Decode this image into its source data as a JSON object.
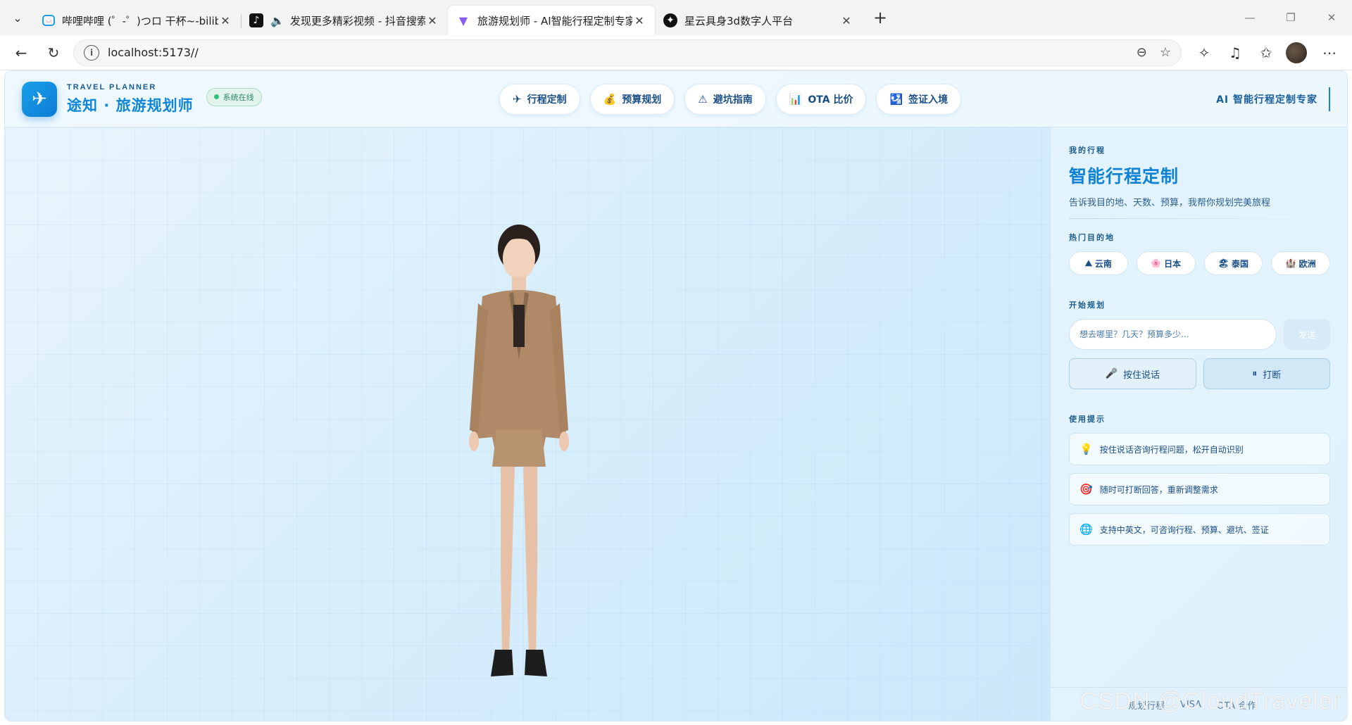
{
  "browser": {
    "tabs": [
      {
        "title": "哔哩哔哩 (゜-゜)つロ 干杯~-bilibili",
        "favicon": "bilibili-icon"
      },
      {
        "title": "发现更多精彩视频 - 抖音搜索",
        "favicon": "douyin-icon"
      },
      {
        "title": "旅游规划师 - AI智能行程定制专家",
        "favicon": "vite-icon"
      },
      {
        "title": "星云具身3d数字人平台",
        "favicon": "nebula-icon"
      }
    ],
    "url": "localhost:5173//"
  },
  "header": {
    "brand_sub": "TRAVEL PLANNER",
    "brand_title": "途知 · 旅游规划师",
    "status": "系统在线",
    "nav": [
      {
        "label": "行程定制",
        "icon": "✈"
      },
      {
        "label": "预算规划",
        "icon": "💰"
      },
      {
        "label": "避坑指南",
        "icon": "⚠"
      },
      {
        "label": "OTA 比价",
        "icon": "📊"
      },
      {
        "label": "签证入境",
        "icon": "🛂"
      }
    ],
    "right_label": "AI 智能行程定制专家"
  },
  "panel": {
    "eyebrow": "我的行程",
    "title": "智能行程定制",
    "desc": "告诉我目的地、天数、预算，我帮你规划完美旅程",
    "hot_label": "热门目的地",
    "destinations": [
      {
        "label": "云南",
        "icon": "⛰"
      },
      {
        "label": "日本",
        "icon": "🌸"
      },
      {
        "label": "泰国",
        "icon": "🏖"
      },
      {
        "label": "欧洲",
        "icon": "🏰"
      }
    ],
    "start_label": "开始规划",
    "input_placeholder": "想去哪里？几天？预算多少...",
    "send_label": "发送",
    "talk_label": "按住说话",
    "interrupt_label": "打断",
    "tips_label": "使用提示",
    "tips": [
      {
        "text": "按住说话咨询行程问题，松开自动识别",
        "icon": "💡"
      },
      {
        "text": "随时可打断回答，重新调整需求",
        "icon": "🎯"
      },
      {
        "text": "支持中英文，可咨询行程、预算、避坑、签证",
        "icon": "🌐"
      }
    ],
    "footer": [
      "规划行程",
      "VISA",
      "OTA 合作"
    ]
  },
  "watermark": "CSDN @CloudTraveler"
}
